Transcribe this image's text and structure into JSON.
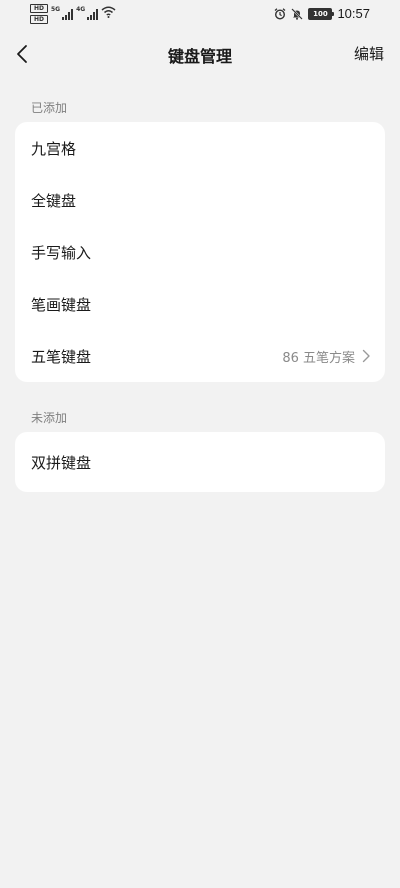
{
  "status_bar": {
    "hd1": "HD",
    "hd2": "HD",
    "net1": "5G",
    "net2": "4G",
    "battery": "100",
    "time": "10:57"
  },
  "header": {
    "title": "键盘管理",
    "edit_label": "编辑"
  },
  "added": {
    "label": "已添加",
    "items": [
      {
        "label": "九宫格",
        "value": ""
      },
      {
        "label": "全键盘",
        "value": ""
      },
      {
        "label": "手写输入",
        "value": ""
      },
      {
        "label": "笔画键盘",
        "value": ""
      },
      {
        "label": "五笔键盘",
        "value": "86 五笔方案"
      }
    ]
  },
  "not_added": {
    "label": "未添加",
    "items": [
      {
        "label": "双拼键盘"
      }
    ]
  },
  "colors": {
    "background": "#f2f2f2",
    "card": "#ffffff",
    "secondary_text": "#808080"
  }
}
